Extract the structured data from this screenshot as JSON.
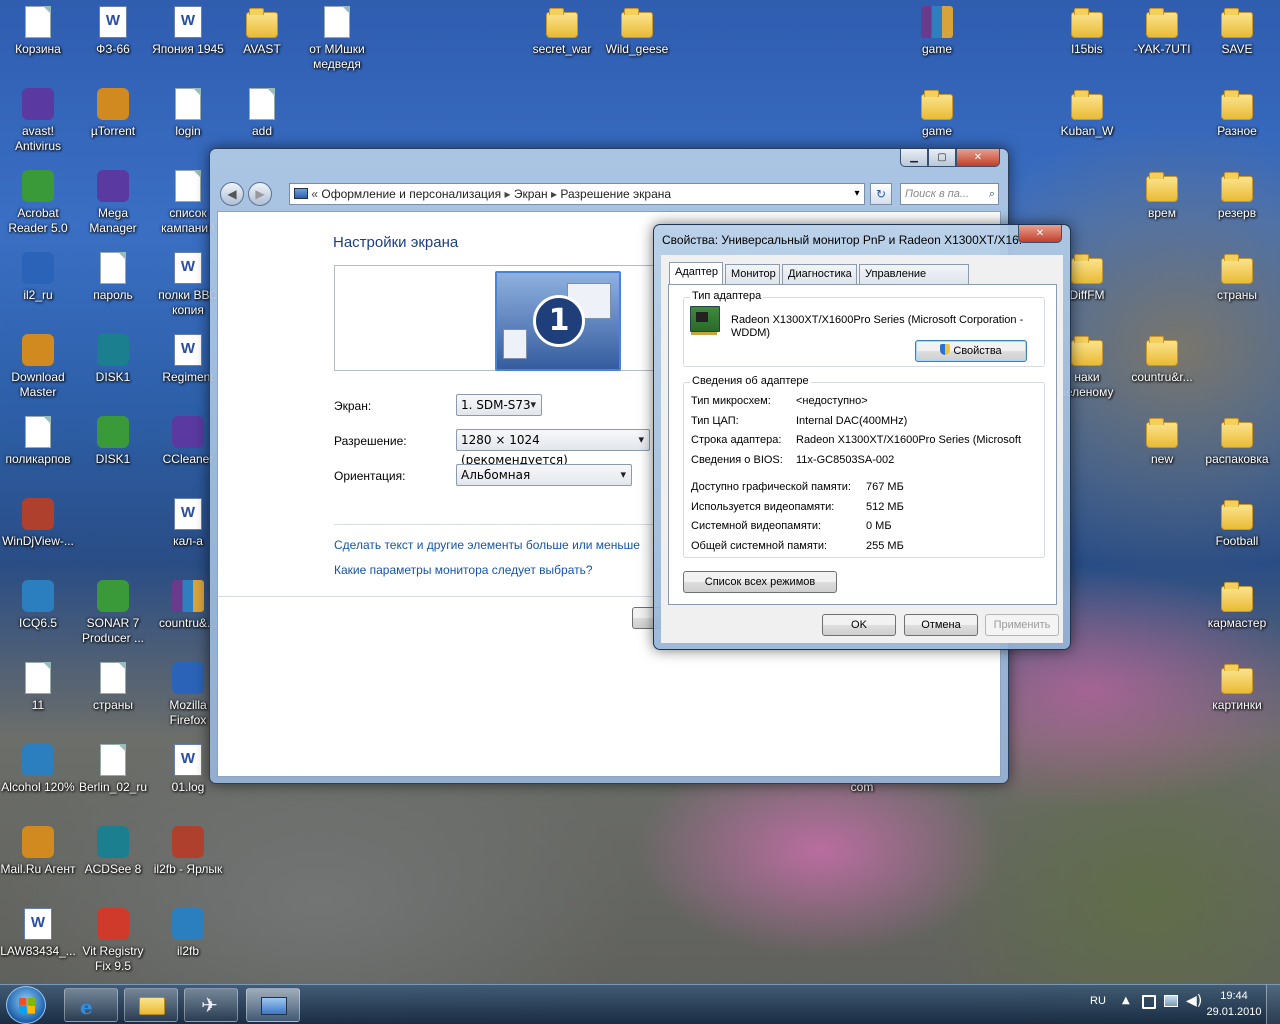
{
  "desktop_icons": [
    {
      "label": "Корзина",
      "kind": "doc"
    },
    {
      "label": "ФЗ-66",
      "kind": "word"
    },
    {
      "label": "Япония 1945",
      "kind": "word"
    },
    {
      "label": "AVAST",
      "kind": "folder"
    },
    {
      "label": "от МИшки медведя",
      "kind": "doc"
    },
    {
      "label": "secret_war",
      "kind": "folder"
    },
    {
      "label": "Wild_geese",
      "kind": "folder"
    },
    {
      "label": "game",
      "kind": "rar"
    },
    {
      "label": "l15bis",
      "kind": "folder"
    },
    {
      "label": "-YAK-7UTI",
      "kind": "folder"
    },
    {
      "label": "SAVE",
      "kind": "folder"
    },
    {
      "label": "avast! Antivirus",
      "kind": "app"
    },
    {
      "label": "µTorrent",
      "kind": "app"
    },
    {
      "label": "login",
      "kind": "doc"
    },
    {
      "label": "add",
      "kind": "doc"
    },
    {
      "label": "game",
      "kind": "folder"
    },
    {
      "label": "Kuban_W",
      "kind": "folder"
    },
    {
      "label": "Разное",
      "kind": "folder"
    },
    {
      "label": "Acrobat Reader 5.0",
      "kind": "app"
    },
    {
      "label": "Mega Manager",
      "kind": "app"
    },
    {
      "label": "список кампаний",
      "kind": "doc"
    },
    {
      "label": "врем",
      "kind": "folder"
    },
    {
      "label": "резерв",
      "kind": "folder"
    },
    {
      "label": "il2_ru",
      "kind": "app"
    },
    {
      "label": "пароль",
      "kind": "doc"
    },
    {
      "label": "полки ВВС копия",
      "kind": "word"
    },
    {
      "label": "DiffFM",
      "kind": "folder"
    },
    {
      "label": "страны",
      "kind": "folder"
    },
    {
      "label": "Download Master",
      "kind": "app"
    },
    {
      "label": "DISK1",
      "kind": "app"
    },
    {
      "label": "Regiment",
      "kind": "word"
    },
    {
      "label": "наки зеленому",
      "kind": "folder"
    },
    {
      "label": "countru&r...",
      "kind": "folder"
    },
    {
      "label": "поликарпов",
      "kind": "doc"
    },
    {
      "label": "DISK1",
      "kind": "app"
    },
    {
      "label": "CCleaner",
      "kind": "app"
    },
    {
      "label": "new",
      "kind": "folder"
    },
    {
      "label": "распаковка",
      "kind": "folder"
    },
    {
      "label": "WinDjView-...",
      "kind": "app"
    },
    {
      "label": "кал-а",
      "kind": "word"
    },
    {
      "label": "Football",
      "kind": "folder"
    },
    {
      "label": "ICQ6.5",
      "kind": "app"
    },
    {
      "label": "SONAR 7 Producer ...",
      "kind": "app"
    },
    {
      "label": "countru&...",
      "kind": "rar"
    },
    {
      "label": "кармастер",
      "kind": "folder"
    },
    {
      "label": "11",
      "kind": "doc"
    },
    {
      "label": "страны",
      "kind": "doc"
    },
    {
      "label": "Mozilla Firefox",
      "kind": "app"
    },
    {
      "label": "картинки",
      "kind": "folder"
    },
    {
      "label": "Alcohol 120%",
      "kind": "app"
    },
    {
      "label": "Berlin_02_ru",
      "kind": "doc"
    },
    {
      "label": "01.log",
      "kind": "word"
    },
    {
      "label": "Mail.Ru Агент",
      "kind": "app"
    },
    {
      "label": "ACDSee 8",
      "kind": "app"
    },
    {
      "label": "il2fb - Ярлык",
      "kind": "app"
    },
    {
      "label": "LAW83434_...",
      "kind": "word"
    },
    {
      "label": "Vit Registry Fix 9.5",
      "kind": "app"
    },
    {
      "label": "il2fb",
      "kind": "app"
    },
    {
      "label": "com",
      "kind": "none"
    }
  ],
  "screen_window": {
    "breadcrumb": {
      "root": "Оформление и персонализация",
      "mid": "Экран",
      "current": "Разрешение экрана"
    },
    "search_placeholder": "Поиск в па...",
    "heading": "Настройки экрана",
    "monitor_number": "1",
    "label_screen": "Экран:",
    "value_screen": "1. SDM-S73",
    "label_resolution": "Разрешение:",
    "value_resolution": "1280 × 1024 (рекомендуется)",
    "label_orientation": "Ориентация:",
    "value_orientation": "Альбомная",
    "link_text_size": "Сделать текст и другие элементы больше или меньше",
    "link_monitor_params": "Какие параметры монитора следует выбрать?"
  },
  "properties_dialog": {
    "title": "Свойства: Универсальный монитор PnP и Radeon X1300XT/X16...",
    "tabs": [
      "Адаптер",
      "Монитор",
      "Диагностика",
      "Управление цветом"
    ],
    "adapter_type_group": "Тип адаптера",
    "adapter_name": "Radeon X1300XT/X1600Pro Series (Microsoft Corporation - WDDM)",
    "properties_button": "Свойства",
    "adapter_info_group": "Сведения об адаптере",
    "info_rows": [
      {
        "label": "Тип микросхем:",
        "value": "<недоступно>"
      },
      {
        "label": "Тип ЦАП:",
        "value": "Internal DAC(400MHz)"
      },
      {
        "label": "Строка адаптера:",
        "value": "Radeon X1300XT/X1600Pro Series (Microsoft"
      },
      {
        "label": "Сведения о BIOS:",
        "value": "11x-GC8503SA-002"
      }
    ],
    "memory_rows": [
      {
        "label": "Доступно графической памяти:",
        "value": "767 МБ"
      },
      {
        "label": "Используется видеопамяти:",
        "value": "512 МБ"
      },
      {
        "label": "Системной видеопамяти:",
        "value": "0 МБ"
      },
      {
        "label": "Общей системной памяти:",
        "value": "255 МБ"
      }
    ],
    "list_modes_button": "Список всех режимов",
    "ok": "OK",
    "cancel": "Отмена",
    "apply": "Применить"
  },
  "taskbar": {
    "language": "RU",
    "time": "19:44",
    "date": "29.01.2010"
  }
}
